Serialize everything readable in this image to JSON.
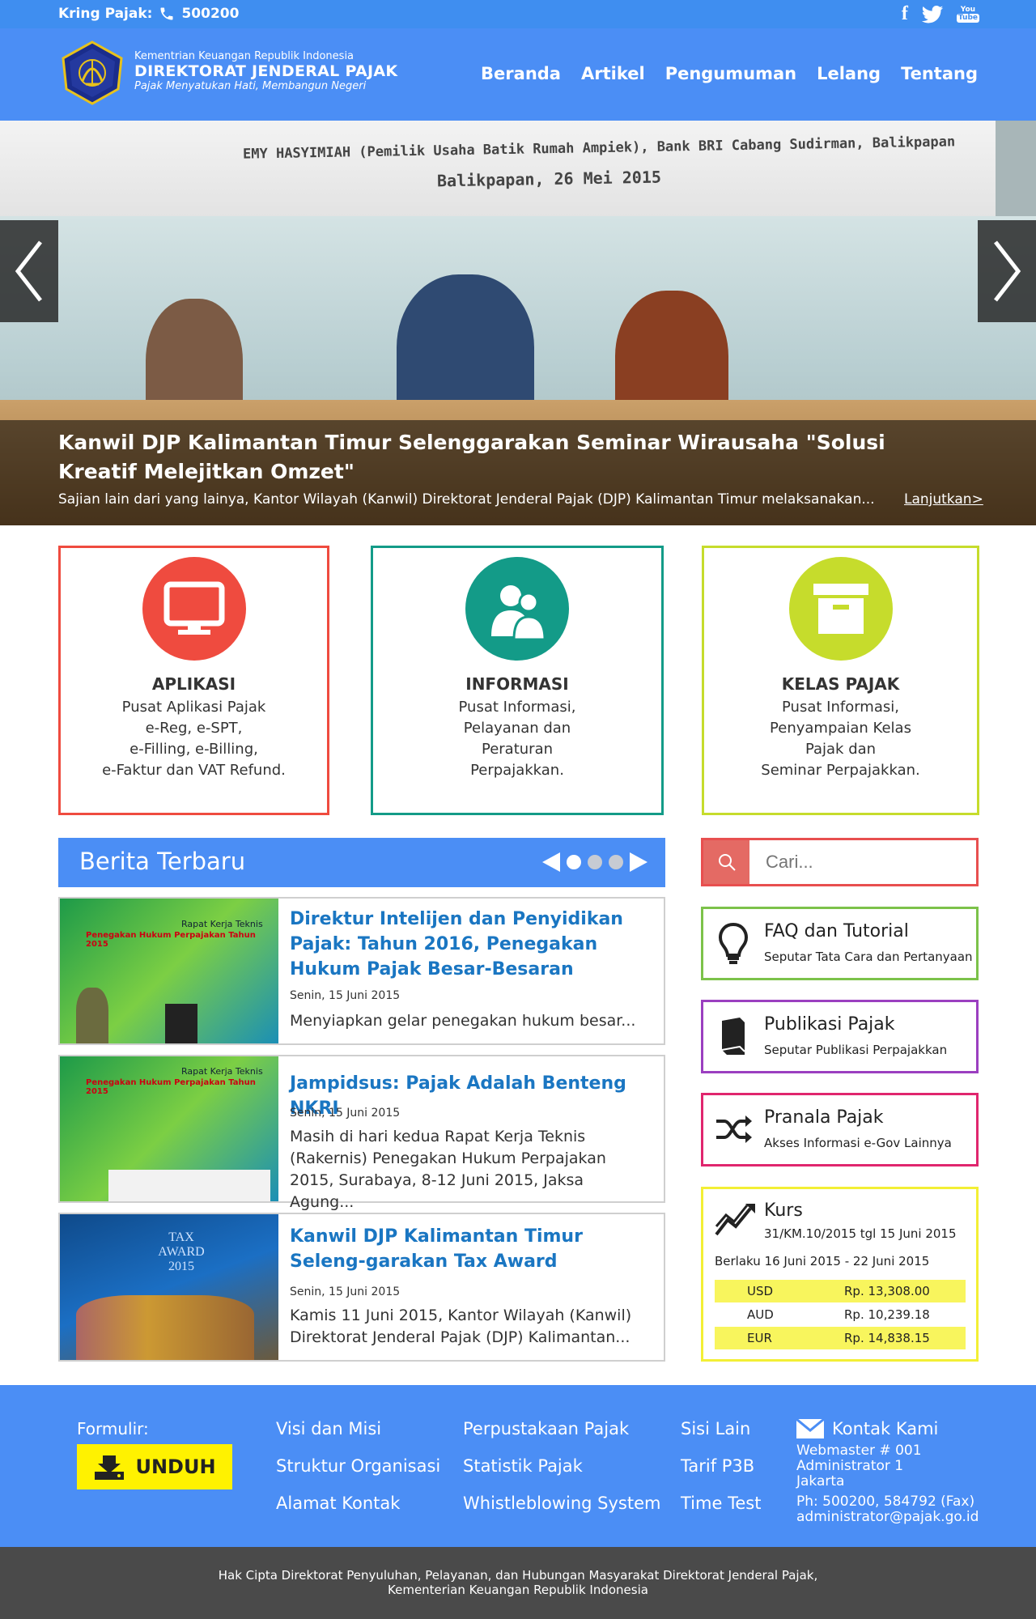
{
  "topbar": {
    "kring_label": "Kring Pajak:",
    "kring_number": "500200",
    "social": {
      "facebook": "f",
      "twitter": "twitter-bird",
      "youtube": "You Tube"
    }
  },
  "header": {
    "brand_line1": "Kementrian Keuangan Republik Indonesia",
    "brand_line2": "DIREKTORAT JENDERAL PAJAK",
    "brand_line3": "Pajak Menyatukan Hati, Membangun Negeri",
    "nav": [
      "Beranda",
      "Artikel",
      "Pengumuman",
      "Lelang",
      "Tentang"
    ]
  },
  "hero": {
    "banner_line1": "EMY HASYIMIAH (Pemilik Usaha Batik Rumah Ampiek), Bank BRI Cabang Sudirman, Balikpapan",
    "banner_line2": "Balikpapan, 26 Mei 2015",
    "title": "Kanwil DJP Kalimantan Timur Selenggarakan Seminar Wirausaha \"Solusi Kreatif Melejitkan Omzet\"",
    "excerpt": "Sajian lain dari yang lainya, Kantor Wilayah (Kanwil) Direktorat Jenderal Pajak (DJP) Kalimantan Timur melaksanakan...",
    "more": "Lanjutkan>"
  },
  "features": [
    {
      "title": "APLIKASI",
      "desc": "Pusat Aplikasi Pajak\ne-Reg, e-SPT,\ne-Filling, e-Billing,\ne-Faktur dan VAT Refund.",
      "color": "#ef4b3f",
      "icon": "monitor-icon"
    },
    {
      "title": "INFORMASI",
      "desc": "Pusat Informasi,\nPelayanan dan\nPeraturan\nPerpajakkan.",
      "color": "#139b88",
      "icon": "users-icon"
    },
    {
      "title": "KELAS PAJAK",
      "desc": "Pusat Informasi,\nPenyampaian Kelas\nPajak dan\nSeminar Perpajakkan.",
      "color": "#c6dc2c",
      "icon": "archive-icon"
    }
  ],
  "news": {
    "heading": "Berita Terbaru",
    "items": [
      {
        "title": "Direktur Intelijen dan Penyidikan Pajak: Tahun 2016, Penegakan Hukum Pajak Besar-Besaran",
        "date": "Senin, 15 Juni 2015",
        "excerpt": "Menyiapkan gelar penegakan hukum besar..."
      },
      {
        "title": "Jampidsus: Pajak Adalah Benteng NKRI",
        "date": "Senin, 15 Juni 2015",
        "excerpt": "Masih di hari kedua Rapat Kerja Teknis (Rakernis) Penegakan Hukum Perpajakan 2015, Surabaya, 8-12 Juni 2015, Jaksa Agung..."
      },
      {
        "title": "Kanwil DJP Kalimantan Timur Seleng-garakan Tax Award",
        "date": "Senin, 15 Juni 2015",
        "excerpt": "Kamis 11 Juni 2015, Kantor Wilayah (Kanwil) Direktorat Jenderal Pajak (DJP) Kalimantan..."
      }
    ],
    "thumb_text": {
      "raker_title": "Rapat Kerja Teknis",
      "raker_sub": "Penegakan Hukum Perpajakan Tahun 2015",
      "tax_award": "TAX AWARD 2015"
    }
  },
  "sidebar": {
    "search_placeholder": "Cari...",
    "boxes": [
      {
        "title": "FAQ dan Tutorial",
        "sub": "Seputar Tata Cara dan Pertanyaan",
        "color": "#7cc24a",
        "icon": "lightbulb-icon"
      },
      {
        "title": "Publikasi Pajak",
        "sub": "Seputar Publikasi Perpajakkan",
        "color": "#9b3fc0",
        "icon": "book-icon"
      },
      {
        "title": "Pranala Pajak",
        "sub": "Akses Informasi e-Gov Lainnya",
        "color": "#e0266e",
        "icon": "shuffle-icon"
      }
    ],
    "kurs": {
      "title": "Kurs",
      "sub": "31/KM.10/2015 tgl 15 Juni 2015",
      "period": "Berlaku 16 Juni 2015 - 22 Juni 2015",
      "rates": [
        {
          "currency": "USD",
          "value": "Rp. 13,308.00"
        },
        {
          "currency": "AUD",
          "value": "Rp. 10,239.18"
        },
        {
          "currency": "EUR",
          "value": "Rp. 14,838.15"
        }
      ],
      "highlight": "#f8f55d"
    }
  },
  "footer": {
    "formulir": "Formulir:",
    "unduh": "UNDUH",
    "col1": [
      "Visi dan Misi",
      "Struktur Organisasi",
      "Alamat Kontak"
    ],
    "col2": [
      "Perpustakaan Pajak",
      "Statistik Pajak",
      "Whistleblowing System"
    ],
    "col3": [
      "Sisi Lain",
      "Tarif P3B",
      "Time Test"
    ],
    "contact_title": "Kontak Kami",
    "contact_lines": [
      "Webmaster # 001",
      "Administrator 1",
      "Jakarta",
      "Ph: 500200, 584792 (Fax)",
      "administrator@pajak.go.id"
    ],
    "copyright_1": "Hak Cipta Direktorat Penyuluhan, Pelayanan, dan Hubungan Masyarakat Direktorat Jenderal Pajak,",
    "copyright_2": "Kementerian Keuangan Republik Indonesia"
  }
}
